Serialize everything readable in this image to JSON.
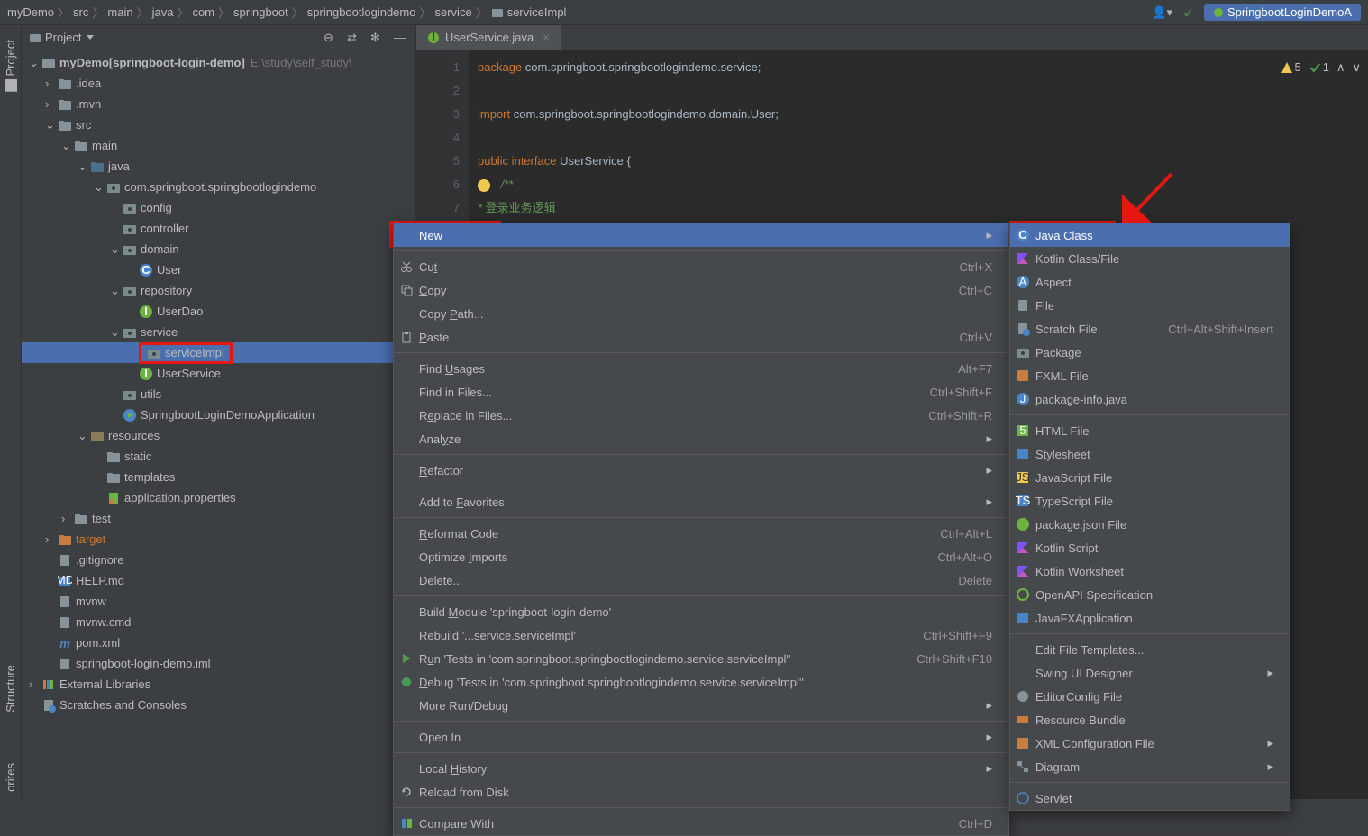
{
  "breadcrumb": [
    "myDemo",
    "src",
    "main",
    "java",
    "com",
    "springboot",
    "springbootlogindemo",
    "service",
    "serviceImpl"
  ],
  "run_config": "SpringbootLoginDemoA",
  "sidebar_labels": {
    "project": "Project",
    "structure": "Structure",
    "favorites": "orites"
  },
  "project_panel_title": "Project",
  "project_header_icons": [
    "collapse",
    "filter",
    "settings",
    "hide"
  ],
  "tree": [
    {
      "depth": 0,
      "arrow": "v",
      "icon": "folder",
      "label": "myDemo",
      "bold": true,
      "suffix": " [springboot-login-demo]",
      "path": "E:\\study\\self_study\\"
    },
    {
      "depth": 1,
      "arrow": ">",
      "icon": "folder",
      "label": ".idea"
    },
    {
      "depth": 1,
      "arrow": ">",
      "icon": "folder",
      "label": ".mvn"
    },
    {
      "depth": 1,
      "arrow": "v",
      "icon": "folder",
      "label": "src"
    },
    {
      "depth": 2,
      "arrow": "v",
      "icon": "folder",
      "label": "main"
    },
    {
      "depth": 3,
      "arrow": "v",
      "icon": "folder-blue",
      "label": "java"
    },
    {
      "depth": 4,
      "arrow": "v",
      "icon": "package",
      "label": "com.springboot.springbootlogindemo"
    },
    {
      "depth": 5,
      "arrow": "",
      "icon": "package",
      "label": "config"
    },
    {
      "depth": 5,
      "arrow": "",
      "icon": "package",
      "label": "controller"
    },
    {
      "depth": 5,
      "arrow": "v",
      "icon": "package",
      "label": "domain"
    },
    {
      "depth": 6,
      "arrow": "",
      "icon": "class",
      "label": "User"
    },
    {
      "depth": 5,
      "arrow": "v",
      "icon": "package",
      "label": "repository"
    },
    {
      "depth": 6,
      "arrow": "",
      "icon": "interface",
      "label": "UserDao"
    },
    {
      "depth": 5,
      "arrow": "v",
      "icon": "package",
      "label": "service"
    },
    {
      "depth": 6,
      "arrow": "",
      "icon": "package",
      "label": "serviceImpl",
      "selected": true,
      "redbox": true
    },
    {
      "depth": 6,
      "arrow": "",
      "icon": "interface",
      "label": "UserService"
    },
    {
      "depth": 5,
      "arrow": "",
      "icon": "package",
      "label": "utils"
    },
    {
      "depth": 5,
      "arrow": "",
      "icon": "class-run",
      "label": "SpringbootLoginDemoApplication"
    },
    {
      "depth": 3,
      "arrow": "v",
      "icon": "folder-res",
      "label": "resources"
    },
    {
      "depth": 4,
      "arrow": "",
      "icon": "folder",
      "label": "static"
    },
    {
      "depth": 4,
      "arrow": "",
      "icon": "folder",
      "label": "templates"
    },
    {
      "depth": 4,
      "arrow": "",
      "icon": "props",
      "label": "application.properties"
    },
    {
      "depth": 2,
      "arrow": ">",
      "icon": "folder",
      "label": "test"
    },
    {
      "depth": 1,
      "arrow": ">",
      "icon": "folder-orange",
      "label": "target",
      "orange": true
    },
    {
      "depth": 1,
      "arrow": "",
      "icon": "file",
      "label": ".gitignore"
    },
    {
      "depth": 1,
      "arrow": "",
      "icon": "md",
      "label": "HELP.md"
    },
    {
      "depth": 1,
      "arrow": "",
      "icon": "file",
      "label": "mvnw"
    },
    {
      "depth": 1,
      "arrow": "",
      "icon": "file",
      "label": "mvnw.cmd"
    },
    {
      "depth": 1,
      "arrow": "",
      "icon": "maven",
      "label": "pom.xml"
    },
    {
      "depth": 1,
      "arrow": "",
      "icon": "file",
      "label": "springboot-login-demo.iml"
    },
    {
      "depth": 0,
      "arrow": ">",
      "icon": "lib",
      "label": "External Libraries"
    },
    {
      "depth": 0,
      "arrow": "",
      "icon": "scratch",
      "label": "Scratches and Consoles"
    }
  ],
  "editor_tab": "UserService.java",
  "inspections": {
    "warn": "5",
    "check": "1"
  },
  "code_lines": [
    {
      "n": 1,
      "html": "<span class='kw'>package</span> <span class='pkg'>com.springboot.springbootlogindemo.service</span>;"
    },
    {
      "n": 2,
      "html": ""
    },
    {
      "n": 3,
      "html": "<span class='kw'>import</span> <span class='pkg'>com.springboot.springbootlogindemo.domain.User</span>;"
    },
    {
      "n": 4,
      "html": ""
    },
    {
      "n": 5,
      "html": "<span class='kw'>public interface</span> <span class='cls'>UserService</span> {"
    },
    {
      "n": 6,
      "html": "    <span class='comment'>/**</span>",
      "bulb": true
    },
    {
      "n": 7,
      "html": "<span class='comment'>     * </span><span class='comment-cn'>登录业务逻辑</span>"
    }
  ],
  "context_menu": [
    {
      "label": "New",
      "selected": true,
      "sub": true,
      "redbox": true,
      "ul": 0
    },
    {
      "sep": true
    },
    {
      "label": "Cut",
      "shortcut": "Ctrl+X",
      "icon": "cut",
      "ul": 2
    },
    {
      "label": "Copy",
      "shortcut": "Ctrl+C",
      "icon": "copy",
      "ul": 0
    },
    {
      "label": "Copy Path...",
      "ul": 5
    },
    {
      "label": "Paste",
      "shortcut": "Ctrl+V",
      "icon": "paste",
      "ul": 0
    },
    {
      "sep": true
    },
    {
      "label": "Find Usages",
      "shortcut": "Alt+F7",
      "ul": 5
    },
    {
      "label": "Find in Files...",
      "shortcut": "Ctrl+Shift+F"
    },
    {
      "label": "Replace in Files...",
      "shortcut": "Ctrl+Shift+R",
      "ul": 1
    },
    {
      "label": "Analyze",
      "sub": true,
      "ul": 4
    },
    {
      "sep": true
    },
    {
      "label": "Refactor",
      "sub": true,
      "ul": 0
    },
    {
      "sep": true
    },
    {
      "label": "Add to Favorites",
      "sub": true,
      "ul": 7
    },
    {
      "sep": true
    },
    {
      "label": "Reformat Code",
      "shortcut": "Ctrl+Alt+L",
      "ul": 0
    },
    {
      "label": "Optimize Imports",
      "shortcut": "Ctrl+Alt+O",
      "ul": 9
    },
    {
      "label": "Delete...",
      "shortcut": "Delete",
      "ul": 0
    },
    {
      "sep": true
    },
    {
      "label": "Build Module 'springboot-login-demo'",
      "ul": 6
    },
    {
      "label": "Rebuild '...service.serviceImpl'",
      "shortcut": "Ctrl+Shift+F9",
      "ul": 1
    },
    {
      "label": "Run 'Tests in 'com.springboot.springbootlogindemo.service.serviceImpl''",
      "shortcut": "Ctrl+Shift+F10",
      "icon": "run",
      "ul": 1
    },
    {
      "label": "Debug 'Tests in 'com.springboot.springbootlogindemo.service.serviceImpl''",
      "icon": "debug",
      "ul": 0
    },
    {
      "label": "More Run/Debug",
      "sub": true
    },
    {
      "sep": true
    },
    {
      "label": "Open In",
      "sub": true
    },
    {
      "sep": true
    },
    {
      "label": "Local History",
      "sub": true,
      "ul": 6
    },
    {
      "label": "Reload from Disk",
      "icon": "reload"
    },
    {
      "sep": true
    },
    {
      "label": "Compare With",
      "shortcut": "Ctrl+D",
      "icon": "diff"
    }
  ],
  "new_submenu": [
    {
      "label": "Java Class",
      "icon": "class",
      "selected": true,
      "redbox": true
    },
    {
      "label": "Kotlin Class/File",
      "icon": "kotlin"
    },
    {
      "label": "Aspect",
      "icon": "aspect"
    },
    {
      "label": "File",
      "icon": "file"
    },
    {
      "label": "Scratch File",
      "shortcut": "Ctrl+Alt+Shift+Insert",
      "icon": "scratch"
    },
    {
      "label": "Package",
      "icon": "package"
    },
    {
      "label": "FXML File",
      "icon": "fxml"
    },
    {
      "label": "package-info.java",
      "icon": "java"
    },
    {
      "sep": true
    },
    {
      "label": "HTML File",
      "icon": "html"
    },
    {
      "label": "Stylesheet",
      "icon": "css"
    },
    {
      "label": "JavaScript File",
      "icon": "js"
    },
    {
      "label": "TypeScript File",
      "icon": "ts"
    },
    {
      "label": "package.json File",
      "icon": "json"
    },
    {
      "label": "Kotlin Script",
      "icon": "kotlin"
    },
    {
      "label": "Kotlin Worksheet",
      "icon": "kotlin"
    },
    {
      "label": "OpenAPI Specification",
      "icon": "openapi"
    },
    {
      "label": "JavaFXApplication",
      "icon": "javafx"
    },
    {
      "sep": true
    },
    {
      "label": "Edit File Templates..."
    },
    {
      "label": "Swing UI Designer",
      "sub": true
    },
    {
      "label": "EditorConfig File",
      "icon": "editorconfig"
    },
    {
      "label": "Resource Bundle",
      "icon": "bundle"
    },
    {
      "label": "XML Configuration File",
      "icon": "xml",
      "sub": true
    },
    {
      "label": "Diagram",
      "icon": "diagram",
      "sub": true
    },
    {
      "sep": true
    },
    {
      "label": "Servlet",
      "icon": "web"
    }
  ]
}
